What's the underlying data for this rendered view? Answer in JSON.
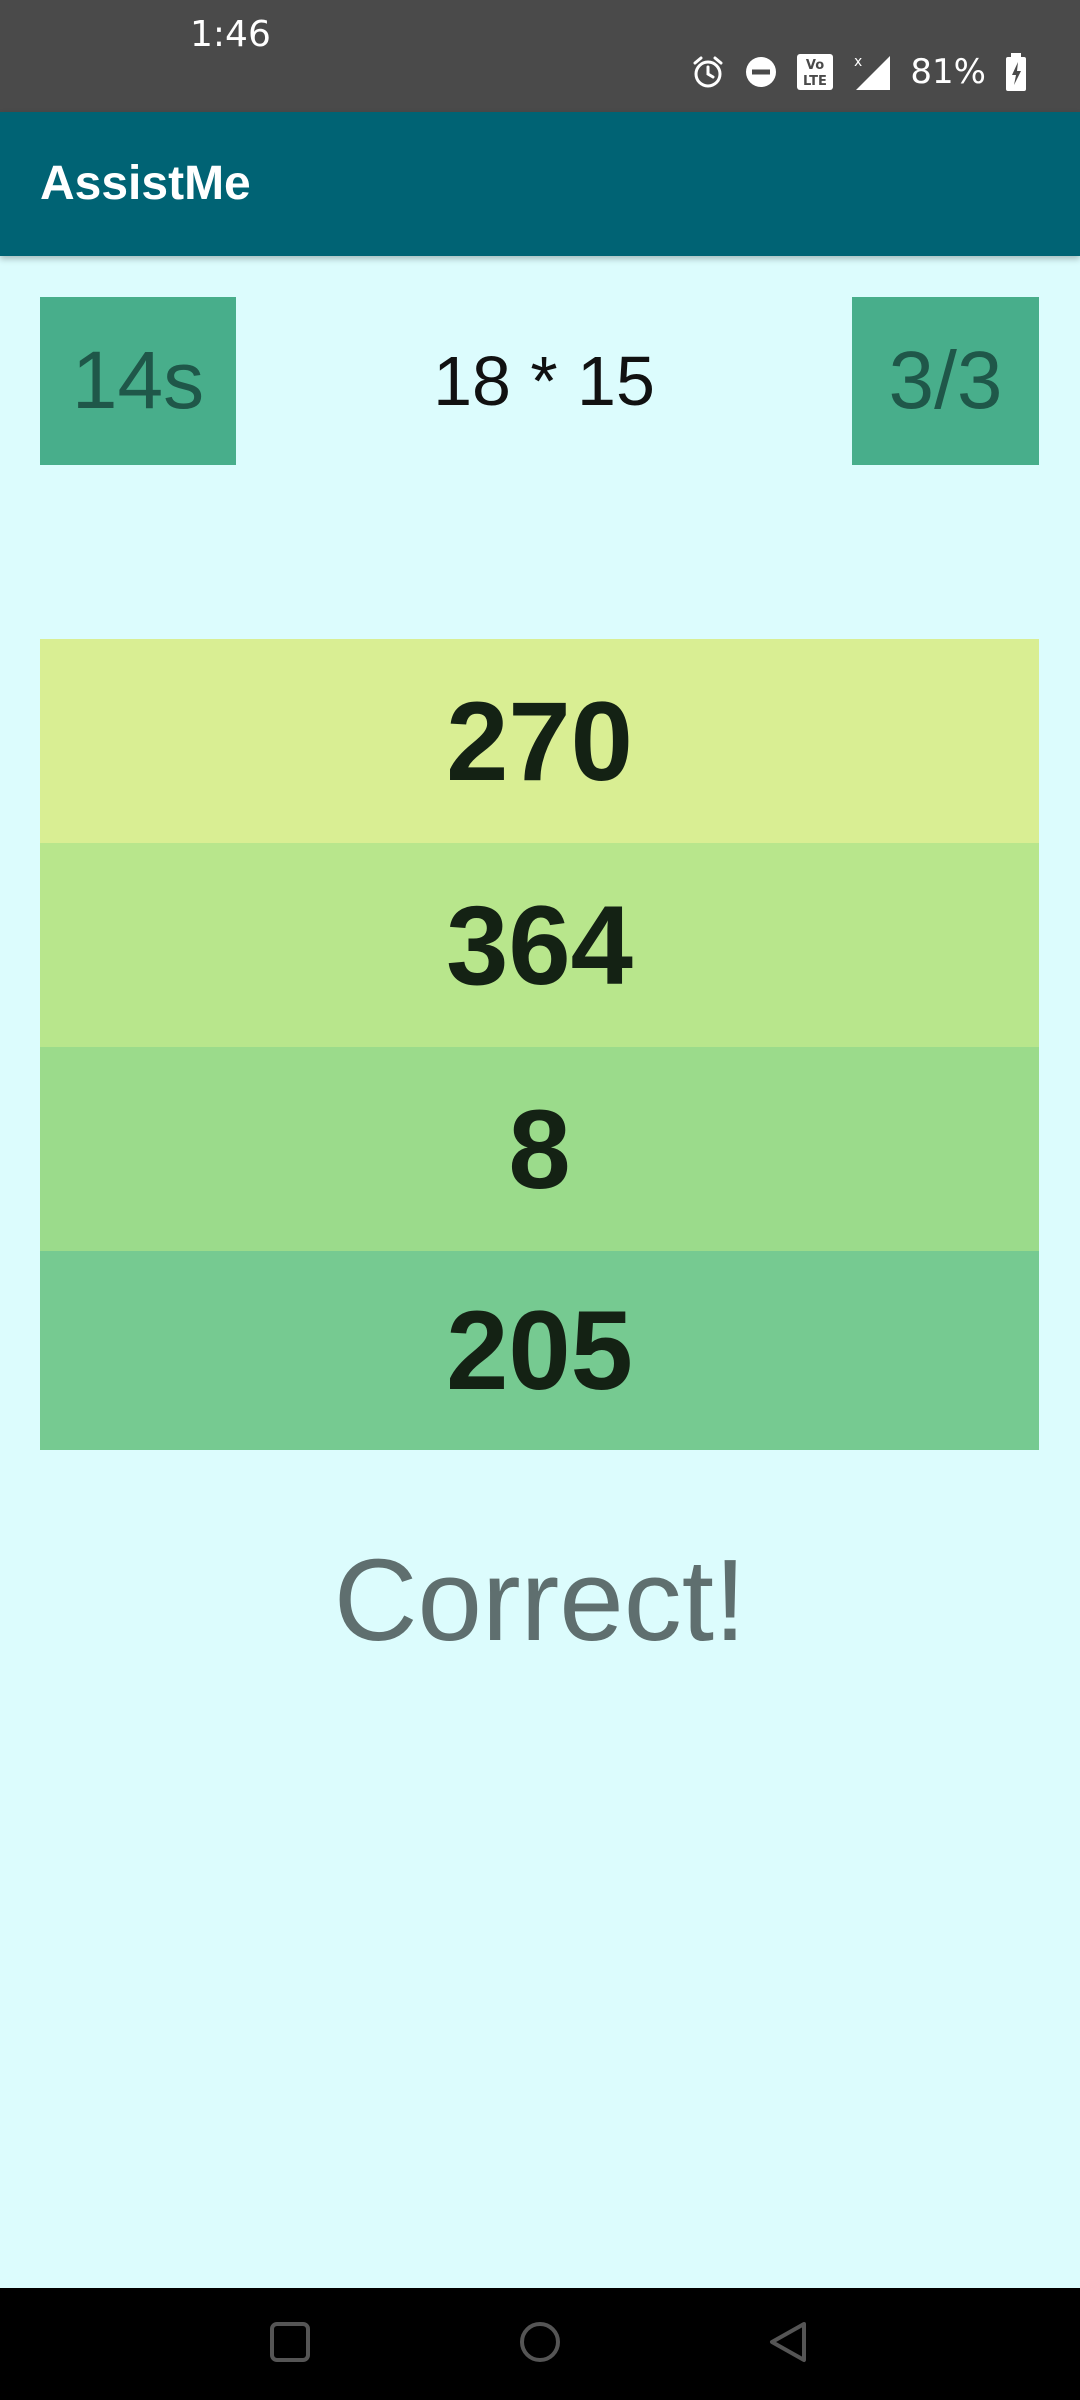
{
  "status_bar": {
    "time": "1:46",
    "battery_percent": "81%",
    "icons": [
      "alarm-icon",
      "do-not-disturb-icon",
      "volte-icon",
      "signal-icon",
      "battery-charging-icon"
    ]
  },
  "app_bar": {
    "title": "AssistMe",
    "color": "#006374"
  },
  "quiz": {
    "timer": "14s",
    "question": "18 * 15",
    "progress": "3/3",
    "answers": [
      "270",
      "364",
      "8",
      "205"
    ],
    "result": "Correct!"
  },
  "colors": {
    "background": "#dcfcfd",
    "badge": "#48ae8b",
    "answer_colors": [
      "#d9ee93",
      "#b8e68c",
      "#9bdb8b",
      "#76ca91"
    ]
  },
  "nav_bar": {
    "icons": [
      "recents-icon",
      "home-icon",
      "back-icon"
    ]
  }
}
